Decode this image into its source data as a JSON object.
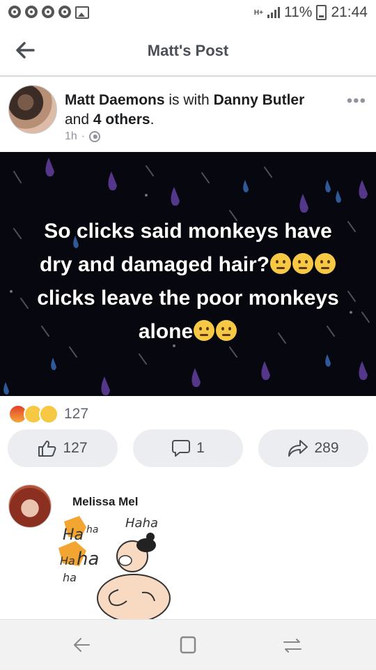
{
  "status_bar": {
    "network": "H+",
    "battery": "11%",
    "time": "21:44",
    "notification_icons": [
      "chrome-icon",
      "chrome-icon",
      "chrome-icon",
      "chrome-icon",
      "image-icon"
    ]
  },
  "header": {
    "title": "Matt's Post",
    "back_icon": "back-arrow-icon"
  },
  "post": {
    "author": "Matt Daemons",
    "with_text": "is with",
    "tagged": "Danny Butler",
    "and_text": "and",
    "others": "4 others",
    "period": ".",
    "time": "1h",
    "separator": "·",
    "privacy_icon": "globe-icon",
    "more_icon": "more-icon",
    "more_label": "•••",
    "image_text": {
      "line1": "So clicks said monkeys have",
      "line2": "dry and damaged hair?",
      "line3": "clicks leave the poor monkeys",
      "line4": "alone"
    }
  },
  "reactions": {
    "icons": [
      "angry-reaction-icon",
      "haha-reaction-icon",
      "wow-reaction-icon"
    ],
    "count": "127"
  },
  "actions": {
    "like_count": "127",
    "comment_count": "1",
    "share_count": "289"
  },
  "comment": {
    "author": "Melissa Mel",
    "sticker_text": [
      "Ha",
      "ha",
      "Haha",
      "Ha",
      "ha",
      "ha"
    ]
  },
  "nav": {
    "back_icon": "nav-back-icon",
    "recents_icon": "recents-icon",
    "switch_icon": "switch-icon"
  },
  "colors": {
    "post_background": "#07070f",
    "pill_background": "#ebedf0",
    "drop_purple": "#5a3a8c",
    "drop_blue": "#3a5a9c"
  }
}
